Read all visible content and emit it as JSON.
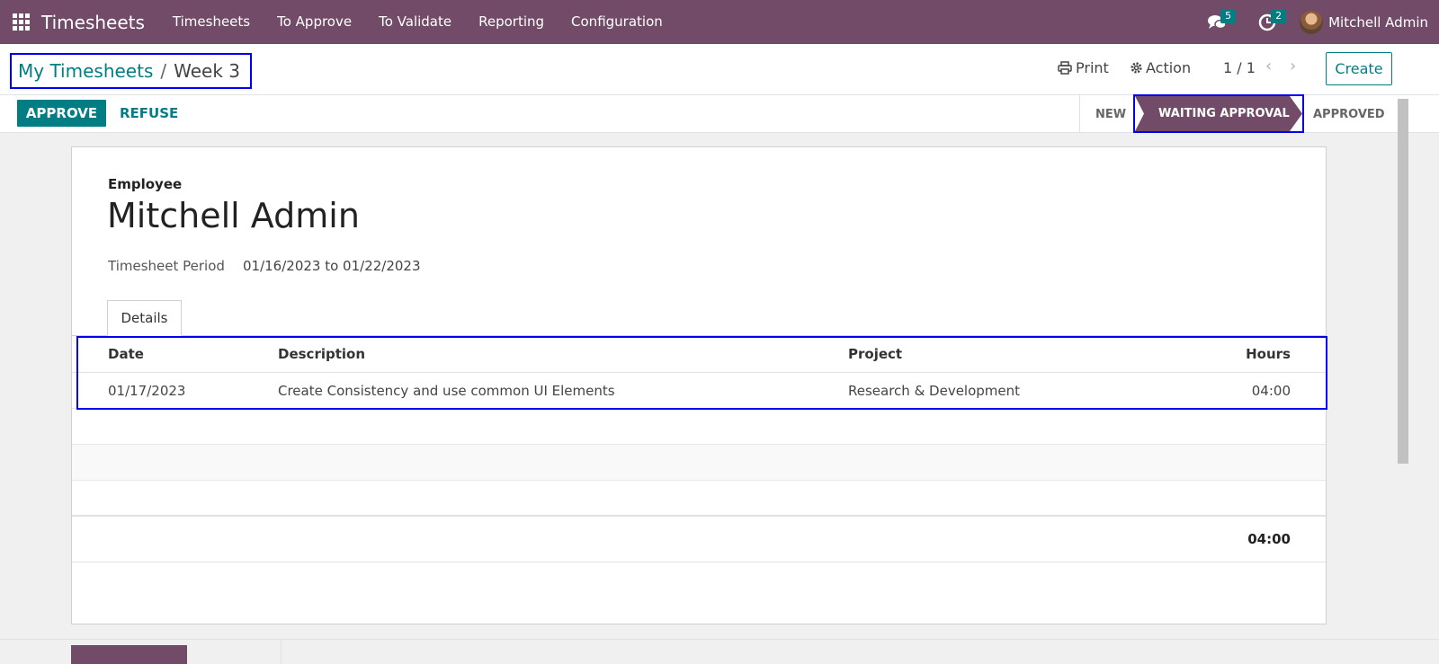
{
  "navbar": {
    "app_name": "Timesheets",
    "menu": [
      "Timesheets",
      "To Approve",
      "To Validate",
      "Reporting",
      "Configuration"
    ],
    "messages_count": "5",
    "activities_count": "2",
    "user_name": "Mitchell Admin"
  },
  "breadcrumb": {
    "parent": "My Timesheets",
    "separator": "/",
    "current": "Week 3"
  },
  "control": {
    "print_label": "Print",
    "action_label": "Action",
    "pager": "1 / 1",
    "create_label": "Create"
  },
  "statusbar": {
    "approve_label": "APPROVE",
    "refuse_label": "REFUSE",
    "stages": [
      "NEW",
      "WAITING APPROVAL",
      "APPROVED"
    ],
    "active_stage": "WAITING APPROVAL"
  },
  "form": {
    "employee_label": "Employee",
    "employee_name": "Mitchell Admin",
    "period_label": "Timesheet Period",
    "period_value": "01/16/2023 to 01/22/2023",
    "tab_label": "Details"
  },
  "table": {
    "columns": [
      "Date",
      "Description",
      "Project",
      "Hours"
    ],
    "rows": [
      {
        "date": "01/17/2023",
        "description": "Create Consistency and use common UI Elements",
        "project": "Research & Development",
        "hours": "04:00"
      }
    ],
    "total": "04:00"
  },
  "colors": {
    "brand": "#714b67",
    "accent": "#017e84",
    "highlight": "#0000ee"
  }
}
